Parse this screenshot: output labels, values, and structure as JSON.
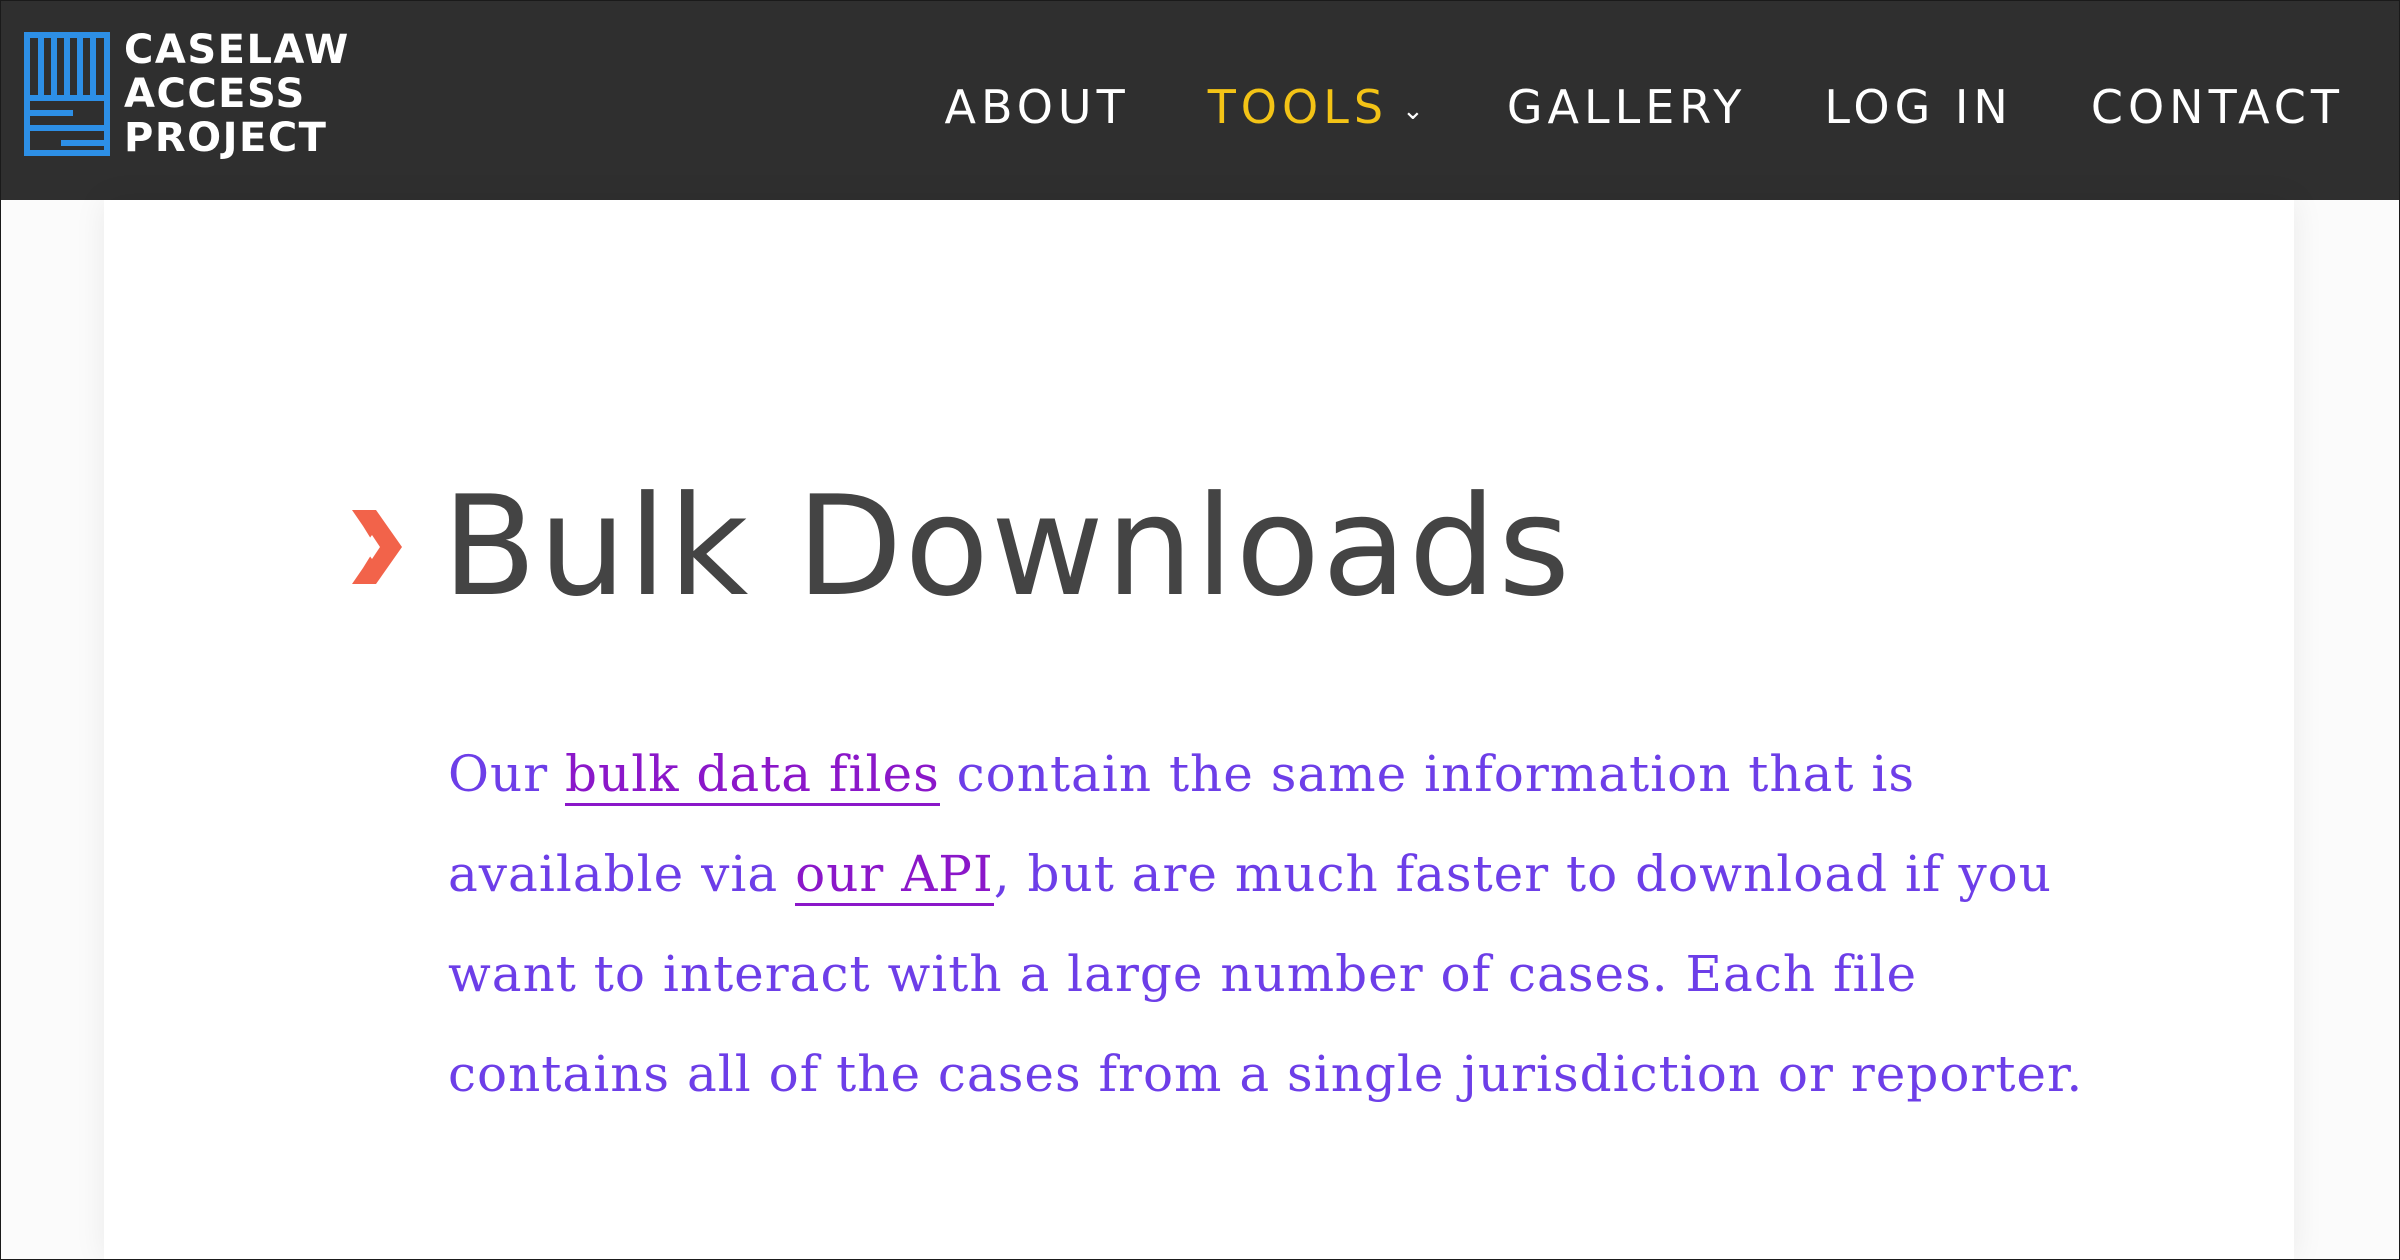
{
  "brand": {
    "lines": [
      "CASELAW",
      "ACCESS",
      "PROJECT"
    ],
    "logo_color": "#2d8fe6"
  },
  "nav": {
    "items": [
      {
        "label": "ABOUT",
        "active": false
      },
      {
        "label": "TOOLS",
        "active": true
      },
      {
        "label": "GALLERY",
        "active": false
      },
      {
        "label": "LOG IN",
        "active": false
      },
      {
        "label": "CONTACT",
        "active": false
      }
    ],
    "active_color": "#f3c316",
    "chevron": "⌄"
  },
  "main": {
    "title": "Bulk Downloads",
    "intro": {
      "text_1": "Our ",
      "link_1": "bulk data files",
      "text_2": " contain the same information that is available via ",
      "link_2": "our API",
      "text_3": ", but are much faster to download if you want to interact with a large number of cases. Each file contains all of the cases from a single jurisdiction or reporter."
    },
    "text_color": "#6d3ee8",
    "link_color": "#8b17c9",
    "accent_color": "#f2634a"
  },
  "icons": {
    "logo": "caselaw-logo-icon",
    "title_marker": "chevron-right-icon"
  }
}
